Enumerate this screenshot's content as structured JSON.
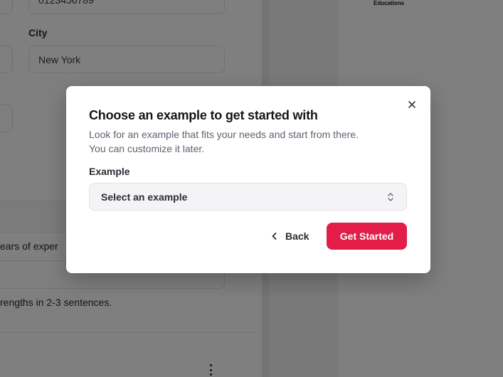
{
  "background": {
    "phone_value": "0123456789",
    "city_label": "City",
    "city_value": "New York",
    "experience_text": "ears of exper",
    "strengths_text": "rengths in 2-3 sentences.",
    "preview_heading": "Educations"
  },
  "modal": {
    "title": "Choose an example to get started with",
    "description_line1": "Look for an example that fits your needs and start from there.",
    "description_line2": "You can customize it later.",
    "example_label": "Example",
    "select_placeholder": "Select an example",
    "back_label": "Back",
    "get_started_label": "Get Started"
  },
  "icons": {
    "close": "close-icon",
    "back": "chevron-left-icon",
    "select": "chevron-up-down-icon",
    "more": "kebab-menu-icon"
  },
  "colors": {
    "accent": "#e11d48",
    "overlay": "rgba(0,0,0,0.5)"
  }
}
